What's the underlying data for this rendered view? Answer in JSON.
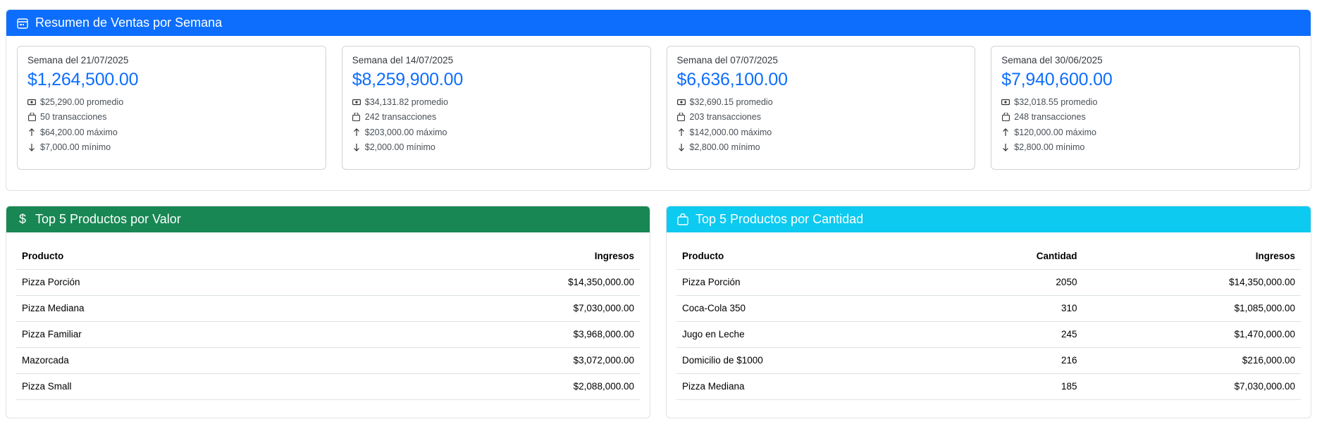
{
  "summary": {
    "title": "Resumen de Ventas por Semana",
    "icon": "calendar-icon",
    "accent": "#0d6efd",
    "weeks": [
      {
        "title": "Semana del 21/07/2025",
        "total": "$1,264,500.00",
        "avg": "$25,290.00 promedio",
        "tx": "50 transacciones",
        "max": "$64,200.00 máximo",
        "min": "$7,000.00 mínimo"
      },
      {
        "title": "Semana del 14/07/2025",
        "total": "$8,259,900.00",
        "avg": "$34,131.82 promedio",
        "tx": "242 transacciones",
        "max": "$203,000.00 máximo",
        "min": "$2,000.00 mínimo"
      },
      {
        "title": "Semana del 07/07/2025",
        "total": "$6,636,100.00",
        "avg": "$32,690.15 promedio",
        "tx": "203 transacciones",
        "max": "$142,000.00 máximo",
        "min": "$2,800.00 mínimo"
      },
      {
        "title": "Semana del 30/06/2025",
        "total": "$7,940,600.00",
        "avg": "$32,018.55 promedio",
        "tx": "248 transacciones",
        "max": "$120,000.00 máximo",
        "min": "$2,800.00 mínimo"
      }
    ]
  },
  "top_value": {
    "title": "Top 5 Productos por Valor",
    "icon": "dollar-icon",
    "accent": "#198754",
    "headers": {
      "product": "Producto",
      "revenue": "Ingresos"
    },
    "rows": [
      {
        "product": "Pizza Porción",
        "revenue": "$14,350,000.00"
      },
      {
        "product": "Pizza Mediana",
        "revenue": "$7,030,000.00"
      },
      {
        "product": "Pizza Familiar",
        "revenue": "$3,968,000.00"
      },
      {
        "product": "Mazorcada",
        "revenue": "$3,072,000.00"
      },
      {
        "product": "Pizza Small",
        "revenue": "$2,088,000.00"
      }
    ]
  },
  "top_qty": {
    "title": "Top 5 Productos por Cantidad",
    "icon": "bag-icon",
    "accent": "#0dcaf0",
    "headers": {
      "product": "Producto",
      "qty": "Cantidad",
      "revenue": "Ingresos"
    },
    "rows": [
      {
        "product": "Pizza Porción",
        "qty": "2050",
        "revenue": "$14,350,000.00"
      },
      {
        "product": "Coca-Cola 350",
        "qty": "310",
        "revenue": "$1,085,000.00"
      },
      {
        "product": "Jugo en Leche",
        "qty": "245",
        "revenue": "$1,470,000.00"
      },
      {
        "product": "Domicilio de $1000",
        "qty": "216",
        "revenue": "$216,000.00"
      },
      {
        "product": "Pizza Mediana",
        "qty": "185",
        "revenue": "$7,030,000.00"
      }
    ]
  }
}
